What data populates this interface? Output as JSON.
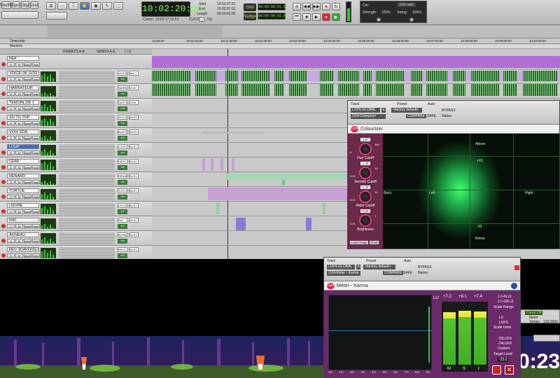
{
  "transport": {
    "timecode": "10:02:20:23",
    "start_label": "Start",
    "end_label": "End",
    "length_label": "Length",
    "start": "10:02:07:01",
    "end": "10:02:07:01",
    "length": "00:00:00:00",
    "cursor_label": "Cursor",
    "cursor": "10:02:17:12.61",
    "sub_readout": "613120",
    "dly_label": "Dly",
    "grid_label": "Grid",
    "grid_value": "00:00:00:01.00",
    "nudge_label": "Nudge",
    "nudge_value": "00:00:00:01.00",
    "cnt_label": "Cnt:",
    "cnt_value": "1/16 note",
    "strength_label": "Strength:",
    "strength_value": "100%",
    "swing_label": "Swing:",
    "swing_value": "100%",
    "top_buttons": [
      "Shuffle",
      "Spot",
      "Slip",
      "Grid"
    ]
  },
  "timeline": {
    "timecode_label": "Timecode",
    "markers_label": "Markers",
    "ticks": [
      "10:00:00",
      "10:01:00:00",
      "10:01:30:00",
      "10:02:00:00",
      "10:03:00:00",
      "10:04:00:00",
      "10:05:00:00",
      "10:06:00:00",
      "10:07:00:00",
      "10:08:00:00",
      "10:09:00:00",
      "10:10:00:00",
      "10:11:00:00"
    ]
  },
  "columns": {
    "inserts": "INSERTS A-E",
    "sends": "SENDS A-E",
    "io": "I / O"
  },
  "tracks": [
    {
      "name": "REF",
      "io": "",
      "vol": "",
      "clip_label": "overview"
    },
    {
      "name": "VOICE OF GOD",
      "io": "VOICE",
      "vol": "vol",
      "io2": "Bus 1"
    },
    {
      "name": "NARRATEUR",
      "io": "NARRAT",
      "vol": "vol",
      "io2": "VOIC"
    },
    {
      "name": "TEMOIN ZIK 1",
      "io": "SAUTI",
      "vol": "-2.6",
      "io2": "OmB"
    },
    {
      "name": "SO TO TOP",
      "io": "SOCO1",
      "vol": "vol",
      "io2": "BASS"
    },
    {
      "name": "VOIX SOA",
      "io": "BUSV1",
      "vol": "vol",
      "io2": "BUSV"
    },
    {
      "name": "LOUP",
      "io": "LOUP",
      "vol": "vol",
      "io2": "BUS1"
    },
    {
      "name": "CERF",
      "io": "CERF",
      "vol": "vol",
      "io2": "BUS1"
    },
    {
      "name": "RENARD",
      "io": "RENAR",
      "vol": "vol",
      "io2": "BUS1"
    },
    {
      "name": "TORTUE",
      "io": "TORTU",
      "vol": "vol",
      "io2": "BUS1"
    },
    {
      "name": "LIEVRE",
      "io": "LIEVR",
      "vol": "vol",
      "io2": "BUS1"
    },
    {
      "name": "RAT",
      "io": "RAT",
      "vol": "vol",
      "io2": "BUS1"
    },
    {
      "name": "AGNEAU",
      "io": "AGNEA",
      "vol": "vol",
      "io2": "BUS1"
    },
    {
      "name": "REV 3DAVOIXEXT",
      "io": "REV1",
      "vol": "vol",
      "io2": "BUS1"
    }
  ],
  "track_buttons": {
    "s": "S",
    "m": "M",
    "wave": "wave",
    "read": "read"
  },
  "colourizer": {
    "track_label": "Track",
    "preset_label": "Preset",
    "auto_label": "Auto",
    "track_value": "LUFS GLOBAL",
    "slot": "a",
    "insert_name": "OZA Colourizer",
    "preset_value": "<factory default>",
    "compare": "COMPARE",
    "safe": "SAFE",
    "bypass": "BYPASS",
    "native": "Native",
    "logo": "OZA",
    "title": "Colourizer",
    "knobs": [
      {
        "label": "Hue Cutoff",
        "value": "100",
        "min": "0",
        "max": "360"
      },
      {
        "label": "Smooth Cutoff",
        "value": "1.00",
        "min": "0.01",
        "max": "10"
      },
      {
        "label": "Rider Cutoff",
        "value": "1.00",
        "min": "0.01",
        "max": "10"
      },
      {
        "label": "Brightness",
        "value": "0.60",
        "min": "0.01",
        "max": "1"
      }
    ],
    "load_image": "Load Image",
    "clear": "Clear",
    "field": {
      "above": "Above",
      "below": "Below",
      "left": "Left",
      "right": "Right",
      "back": "Back",
      "plus10": "+10",
      "minus10": "-10"
    }
  },
  "meter": {
    "track_label": "Track",
    "preset_label": "Preset",
    "auto_label": "Auto",
    "track_value": "LUFS GLOBAL",
    "slot": "d",
    "insert_name": "OZA Meter - Karma",
    "preset_value": "<factory default>",
    "compare": "COMPARE",
    "safe": "SAFE",
    "bypass": "BYPASS",
    "native": "Native",
    "logo": "OZA",
    "title": "Meter - Karma",
    "lu_label": "LU",
    "peaks": [
      "+7.2",
      "+8.1",
      "+7.4"
    ],
    "bar_levels": [
      0.92,
      0.94,
      0.93
    ],
    "channels": [
      "M",
      "S",
      "I"
    ],
    "x_ticks": [
      "0m",
      "1m",
      "2m",
      "3m",
      "4m",
      "5m",
      "6m",
      "7m",
      "8m",
      "9m"
    ],
    "scale_range": "Scale Range",
    "scale_opt1": "1 (+9LU)",
    "scale_opt2": "2 (+18LU)",
    "scale_units": "Scale Units",
    "unit1": "LU",
    "unit2": "LUFS",
    "target_level": "Target Level",
    "target1": "-23LUFS",
    "target2": "-24LUFS",
    "target3": "Custom",
    "target_value": "-23.0"
  },
  "mini": {
    "label": "Count Off",
    "meter": "Meter",
    "tempo": "Tempo",
    "tempo_value": "120.0000"
  },
  "big_counter": "0:23"
}
